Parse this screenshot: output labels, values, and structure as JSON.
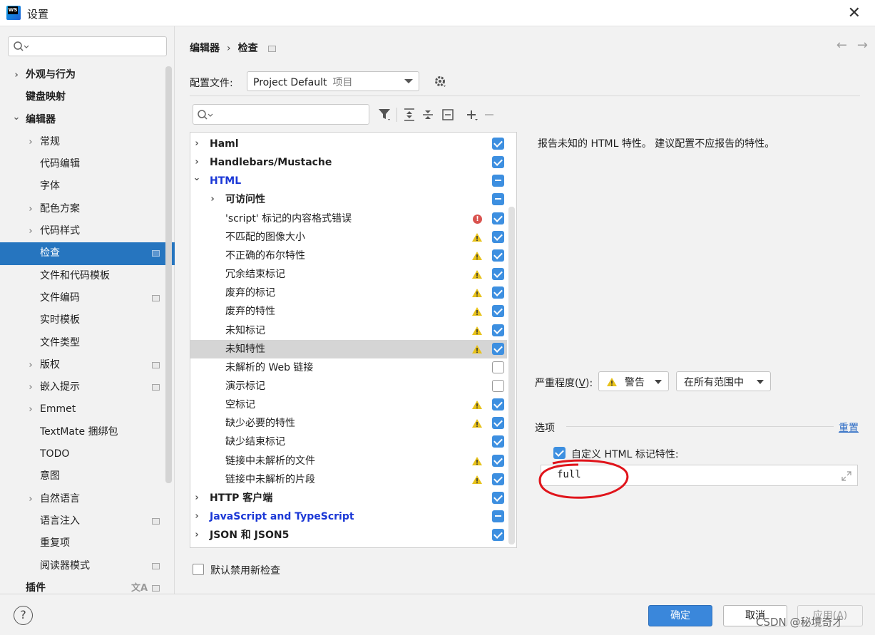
{
  "window": {
    "title": "设置",
    "app_icon_text": "WS"
  },
  "sidebar": {
    "search_placeholder": "",
    "items": [
      {
        "label": "外观与行为",
        "bold": true,
        "chevron": "right",
        "level": 0,
        "badge": ""
      },
      {
        "label": "键盘映射",
        "bold": true,
        "chevron": "",
        "level": 0,
        "badge": ""
      },
      {
        "label": "编辑器",
        "bold": true,
        "chevron": "down",
        "level": 0,
        "badge": ""
      },
      {
        "label": "常规",
        "bold": false,
        "chevron": "right",
        "level": 1,
        "badge": ""
      },
      {
        "label": "代码编辑",
        "bold": false,
        "chevron": "",
        "level": 1,
        "badge": ""
      },
      {
        "label": "字体",
        "bold": false,
        "chevron": "",
        "level": 1,
        "badge": ""
      },
      {
        "label": "配色方案",
        "bold": false,
        "chevron": "right",
        "level": 1,
        "badge": ""
      },
      {
        "label": "代码样式",
        "bold": false,
        "chevron": "right",
        "level": 1,
        "badge": ""
      },
      {
        "label": "检查",
        "bold": false,
        "chevron": "",
        "level": 1,
        "badge": "page",
        "selected": true
      },
      {
        "label": "文件和代码模板",
        "bold": false,
        "chevron": "",
        "level": 1,
        "badge": ""
      },
      {
        "label": "文件编码",
        "bold": false,
        "chevron": "",
        "level": 1,
        "badge": "page"
      },
      {
        "label": "实时模板",
        "bold": false,
        "chevron": "",
        "level": 1,
        "badge": ""
      },
      {
        "label": "文件类型",
        "bold": false,
        "chevron": "",
        "level": 1,
        "badge": ""
      },
      {
        "label": "版权",
        "bold": false,
        "chevron": "right",
        "level": 1,
        "badge": "page"
      },
      {
        "label": "嵌入提示",
        "bold": false,
        "chevron": "right",
        "level": 1,
        "badge": "page"
      },
      {
        "label": "Emmet",
        "bold": false,
        "chevron": "right",
        "level": 1,
        "badge": ""
      },
      {
        "label": "TextMate 捆绑包",
        "bold": false,
        "chevron": "",
        "level": 1,
        "badge": ""
      },
      {
        "label": "TODO",
        "bold": false,
        "chevron": "",
        "level": 1,
        "badge": ""
      },
      {
        "label": "意图",
        "bold": false,
        "chevron": "",
        "level": 1,
        "badge": ""
      },
      {
        "label": "自然语言",
        "bold": false,
        "chevron": "right",
        "level": 1,
        "badge": ""
      },
      {
        "label": "语言注入",
        "bold": false,
        "chevron": "",
        "level": 1,
        "badge": "page"
      },
      {
        "label": "重复项",
        "bold": false,
        "chevron": "",
        "level": 1,
        "badge": ""
      },
      {
        "label": "阅读器模式",
        "bold": false,
        "chevron": "",
        "level": 1,
        "badge": "page"
      },
      {
        "label": "插件",
        "bold": true,
        "chevron": "",
        "level": 0,
        "badge": "lang+page"
      }
    ]
  },
  "breadcrumb": {
    "part1": "编辑器",
    "separator": "›",
    "part2": "检查"
  },
  "nav": {
    "back": "←",
    "forward": "→"
  },
  "profile": {
    "label": "配置文件:",
    "value": "Project Default",
    "scope": "项目"
  },
  "filter": {
    "placeholder": ""
  },
  "toolbar": {
    "icons": [
      "filter-icon",
      "expand-all-icon",
      "collapse-all-icon",
      "reset-icon",
      "add-icon",
      "remove-icon"
    ]
  },
  "inspections": [
    {
      "label": "Haml",
      "bold": true,
      "blue": false,
      "chevron": "right",
      "level": 0,
      "severity": "",
      "check": "on"
    },
    {
      "label": "Handlebars/Mustache",
      "bold": true,
      "blue": false,
      "chevron": "right",
      "level": 0,
      "severity": "",
      "check": "on"
    },
    {
      "label": "HTML",
      "bold": true,
      "blue": true,
      "chevron": "down",
      "level": 0,
      "severity": "",
      "check": "mixed"
    },
    {
      "label": "可访问性",
      "bold": true,
      "blue": false,
      "chevron": "right",
      "level": 1,
      "severity": "",
      "check": "mixed"
    },
    {
      "label": "'script' 标记的内容格式错误",
      "bold": false,
      "blue": false,
      "chevron": "",
      "level": 1,
      "severity": "error",
      "check": "on"
    },
    {
      "label": "不匹配的图像大小",
      "bold": false,
      "blue": false,
      "chevron": "",
      "level": 1,
      "severity": "warning",
      "check": "on"
    },
    {
      "label": "不正确的布尔特性",
      "bold": false,
      "blue": false,
      "chevron": "",
      "level": 1,
      "severity": "warning",
      "check": "on"
    },
    {
      "label": "冗余结束标记",
      "bold": false,
      "blue": false,
      "chevron": "",
      "level": 1,
      "severity": "warning",
      "check": "on"
    },
    {
      "label": "废弃的标记",
      "bold": false,
      "blue": false,
      "chevron": "",
      "level": 1,
      "severity": "warning",
      "check": "on"
    },
    {
      "label": "废弃的特性",
      "bold": false,
      "blue": false,
      "chevron": "",
      "level": 1,
      "severity": "warning",
      "check": "on"
    },
    {
      "label": "未知标记",
      "bold": false,
      "blue": false,
      "chevron": "",
      "level": 1,
      "severity": "warning",
      "check": "on"
    },
    {
      "label": "未知特性",
      "bold": false,
      "blue": false,
      "chevron": "",
      "level": 1,
      "severity": "warning",
      "check": "on",
      "highlighted": true
    },
    {
      "label": "未解析的 Web 链接",
      "bold": false,
      "blue": false,
      "chevron": "",
      "level": 1,
      "severity": "",
      "check": "off"
    },
    {
      "label": "演示标记",
      "bold": false,
      "blue": false,
      "chevron": "",
      "level": 1,
      "severity": "",
      "check": "off"
    },
    {
      "label": "空标记",
      "bold": false,
      "blue": false,
      "chevron": "",
      "level": 1,
      "severity": "warning",
      "check": "on"
    },
    {
      "label": "缺少必要的特性",
      "bold": false,
      "blue": false,
      "chevron": "",
      "level": 1,
      "severity": "warning",
      "check": "on"
    },
    {
      "label": "缺少结束标记",
      "bold": false,
      "blue": false,
      "chevron": "",
      "level": 1,
      "severity": "",
      "check": "on"
    },
    {
      "label": "链接中未解析的文件",
      "bold": false,
      "blue": false,
      "chevron": "",
      "level": 1,
      "severity": "warning",
      "check": "on"
    },
    {
      "label": "链接中未解析的片段",
      "bold": false,
      "blue": false,
      "chevron": "",
      "level": 1,
      "severity": "warning",
      "check": "on"
    },
    {
      "label": "HTTP 客户端",
      "bold": true,
      "blue": false,
      "chevron": "right",
      "level": 0,
      "severity": "",
      "check": "on"
    },
    {
      "label": "JavaScript and TypeScript",
      "bold": true,
      "blue": true,
      "chevron": "right",
      "level": 0,
      "severity": "",
      "check": "mixed"
    },
    {
      "label": "JSON 和 JSON5",
      "bold": true,
      "blue": false,
      "chevron": "right",
      "level": 0,
      "severity": "",
      "check": "on"
    }
  ],
  "default_disable": {
    "label": "默认禁用新检查",
    "checked": false
  },
  "details": {
    "description": "报告未知的 HTML 特性。 建议配置不应报告的特性。",
    "severity_label_prefix": "严重程度(",
    "severity_label_mnemonic": "V",
    "severity_label_suffix": "):",
    "severity_value": "警告",
    "scope_value": "在所有范围中",
    "options_label": "选项",
    "reset_label": "重置",
    "custom_attr_label": "自定义 HTML 标记特性:",
    "custom_attr_checked": true,
    "custom_attr_value": "full"
  },
  "footer": {
    "help": "?",
    "ok": "确定",
    "cancel": "取消",
    "apply": "应用(A)",
    "watermark": "CSDN @秘境奇才"
  },
  "colors": {
    "accent": "#3d8fe0",
    "selection": "#2675bf",
    "link": "#2a6ac4",
    "annotation_red": "#e0141b",
    "warning": "#e8c21a",
    "error": "#d9534f"
  }
}
